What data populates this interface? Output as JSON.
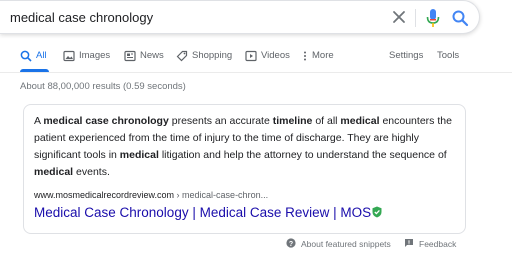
{
  "search": {
    "query": "medical case chronology"
  },
  "tabs": [
    {
      "label": "All",
      "icon": "search-icon",
      "active": true
    },
    {
      "label": "Images",
      "icon": "image-icon"
    },
    {
      "label": "News",
      "icon": "news-icon"
    },
    {
      "label": "Shopping",
      "icon": "tag-icon"
    },
    {
      "label": "Videos",
      "icon": "play-icon"
    },
    {
      "label": "More",
      "icon": "more-vert-icon"
    }
  ],
  "tools": {
    "settings": "Settings",
    "tools": "Tools"
  },
  "result_stats": "About 88,00,000 results (0.59 seconds)",
  "snippet": {
    "parts": [
      {
        "text": "A ",
        "bold": false
      },
      {
        "text": "medical case chronology",
        "bold": true
      },
      {
        "text": " presents an accurate ",
        "bold": false
      },
      {
        "text": "timeline",
        "bold": true
      },
      {
        "text": " of all ",
        "bold": false
      },
      {
        "text": "medical",
        "bold": true
      },
      {
        "text": " encounters the patient experienced from the time of injury to the time of discharge. They are highly significant tools in ",
        "bold": false
      },
      {
        "text": "medical",
        "bold": true
      },
      {
        "text": " litigation and help the attorney to understand the sequence of ",
        "bold": false
      },
      {
        "text": "medical",
        "bold": true
      },
      {
        "text": " events.",
        "bold": false
      }
    ],
    "cite_domain": "www.mosmedicalrecordreview.com",
    "cite_path": " › medical-case-chron...",
    "link_title": "Medical Case Chronology | Medical Case Review | MOS"
  },
  "footer": {
    "about": "About featured snippets",
    "feedback": "Feedback"
  },
  "colors": {
    "link": "#1a0dab",
    "accent": "#1a73e8",
    "verified": "#34a853",
    "mic_blue": "#4285f4",
    "mic_red": "#ea4335"
  }
}
